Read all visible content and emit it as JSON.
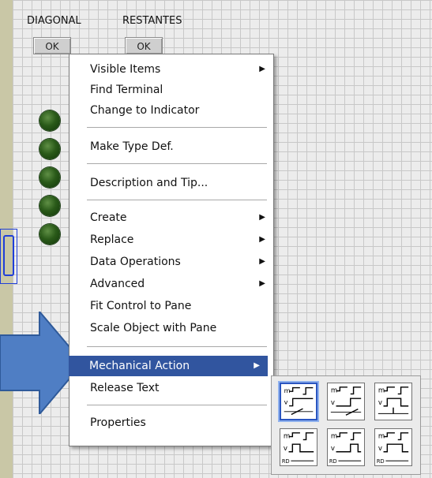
{
  "front_panel": {
    "label_diagonal": "DIAGONAL",
    "label_restantes": "RESTANTES",
    "button_diagonal": "OK",
    "button_restantes": "OK",
    "led_count": 5,
    "led_color": "#2a5a19"
  },
  "context_menu": {
    "items": [
      {
        "label": "Visible Items",
        "submenu": true
      },
      {
        "label": "Find Terminal",
        "submenu": false
      },
      {
        "label": "Change to Indicator",
        "submenu": false
      },
      {
        "label": "Make Type Def.",
        "submenu": false
      },
      {
        "label": "Description and Tip...",
        "submenu": false
      },
      {
        "label": "Create",
        "submenu": true
      },
      {
        "label": "Replace",
        "submenu": true
      },
      {
        "label": "Data Operations",
        "submenu": true
      },
      {
        "label": "Advanced",
        "submenu": true
      },
      {
        "label": "Fit Control to Pane",
        "submenu": false
      },
      {
        "label": "Scale Object with Pane",
        "submenu": false
      },
      {
        "label": "Mechanical Action",
        "submenu": true,
        "highlighted": true
      },
      {
        "label": "Release Text",
        "submenu": false
      },
      {
        "label": "Properties",
        "submenu": false
      }
    ],
    "highlight_color": "#31559f"
  },
  "mechanical_action_palette": {
    "tiles": [
      {
        "icon": "switch-when-pressed-icon",
        "caption": "",
        "selected": true
      },
      {
        "icon": "switch-when-released-icon",
        "caption": "",
        "selected": false
      },
      {
        "icon": "switch-until-released-icon",
        "caption": "",
        "selected": false
      },
      {
        "icon": "latch-when-pressed-icon",
        "caption": "RD",
        "selected": false
      },
      {
        "icon": "latch-when-released-icon",
        "caption": "RD",
        "selected": false
      },
      {
        "icon": "latch-until-released-icon",
        "caption": "RD",
        "selected": false
      }
    ],
    "tile_label_m": "m",
    "tile_label_v": "v"
  },
  "accent_arrow_color": "#4f7ec4",
  "wire_color": "#1f3fd8"
}
